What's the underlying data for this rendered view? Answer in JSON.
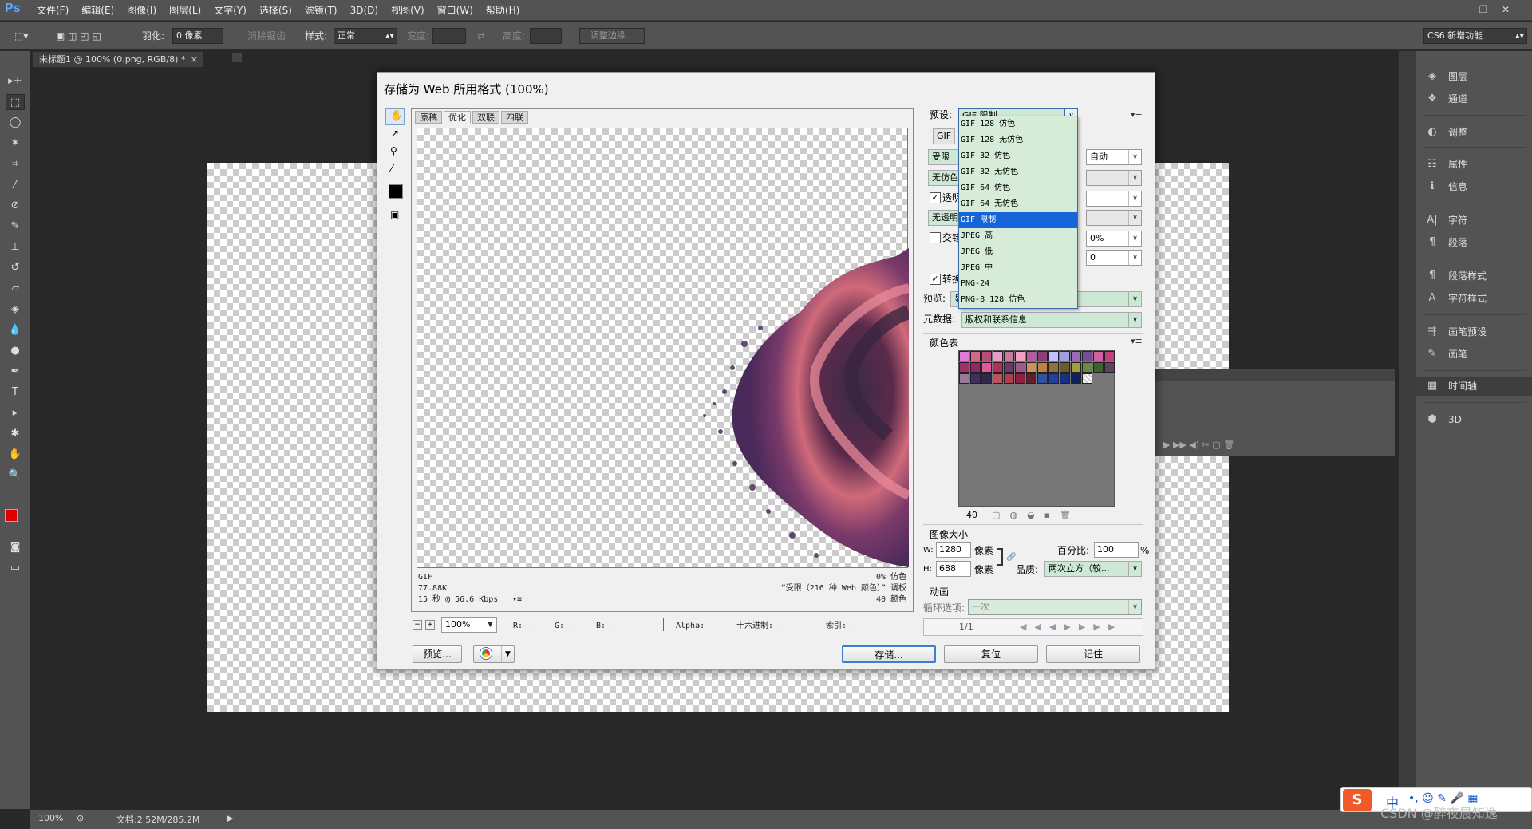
{
  "app": {
    "logo": "Ps",
    "menu": [
      "文件(F)",
      "编辑(E)",
      "图像(I)",
      "图层(L)",
      "文字(Y)",
      "选择(S)",
      "滤镜(T)",
      "3D(D)",
      "视图(V)",
      "窗口(W)",
      "帮助(H)"
    ],
    "window_buttons": [
      "—",
      "❐",
      "✕"
    ]
  },
  "options_bar": {
    "feather_label": "羽化:",
    "feather_value": "0 像素",
    "antialias_label": "消除锯齿",
    "style_label": "样式:",
    "style_value": "正常",
    "width_label": "宽度:",
    "height_label": "高度:",
    "refine_edge_button": "调整边缘...",
    "workspace": "CS6 新增功能"
  },
  "document_tab": "未标题1 @ 100% (0.png, RGB/8) *",
  "panels": {
    "items": [
      "图层",
      "通道",
      "调整",
      "属性",
      "信息",
      "字符",
      "段落",
      "段落样式",
      "字符样式",
      "画笔预设",
      "画笔",
      "时间轴",
      "3D"
    ]
  },
  "status": {
    "zoom": "100%",
    "doc_info": "文档:2.52M/285.2M"
  },
  "dialog": {
    "title": "存储为 Web 所用格式 (100%)",
    "tabs": [
      "原稿",
      "优化",
      "双联",
      "四联"
    ],
    "preview_info": {
      "format": "GIF",
      "size": "77.88K",
      "time": "15 秒 @ 56.6 Kbps",
      "dither": "0% 仿色",
      "palette": "“受限（216 种 Web 颜色）” 调板",
      "colors": "40 颜色"
    },
    "zoom_value": "100%",
    "readout": {
      "r": "R: —",
      "g": "G: —",
      "b": "B: —",
      "alpha": "Alpha: —",
      "hex": "十六进制: —",
      "index": "索引: —"
    },
    "preset_label": "预设:",
    "preset_value": "GIF 限制",
    "format_value": "GIF",
    "reduction_value": "受限",
    "dither_value": "无仿色",
    "transparency_label": "透明",
    "matte_value": "无透明",
    "interlace_label": "交错",
    "convert_label": "转换",
    "preview_label": "预览:",
    "preview_value": "显",
    "metadata_label": "元数据:",
    "metadata_value": "版权和联系信息",
    "colors_value": "自动",
    "dither_pct": "0%",
    "websnap": "0",
    "color_table_label": "颜色表",
    "color_count": "40",
    "image_size_label": "图像大小",
    "w_label": "W:",
    "w_value": "1280",
    "h_label": "H:",
    "h_value": "688",
    "px_unit": "像素",
    "percent_label": "百分比:",
    "percent_value": "100",
    "percent_unit": "%",
    "quality_label": "品质:",
    "quality_value": "两次立方（较...",
    "animation_label": "动画",
    "loop_label": "循环选项:",
    "loop_value": "一次",
    "frame_counter": "1/1",
    "buttons": {
      "preview": "预览...",
      "save": "存储...",
      "reset": "复位",
      "remember": "记住"
    },
    "dropdown_items": [
      "GIF 128 仿色",
      "GIF 128 无仿色",
      "GIF 32 仿色",
      "GIF 32 无仿色",
      "GIF 64 仿色",
      "GIF 64 无仿色",
      "GIF 限制",
      "JPEG 高",
      "JPEG 低",
      "JPEG 中",
      "PNG-24",
      "PNG-8 128 仿色"
    ],
    "dropdown_selected_index": 6,
    "swatch_colors": [
      "#e07ad8",
      "#d16a8a",
      "#b84c7a",
      "#e59ccb",
      "#c87aa0",
      "#f0a0c0",
      "#b85aa0",
      "#8a3f78",
      "#c0c0ff",
      "#a0a0e0",
      "#9a6ab8",
      "#7a4a9a",
      "#d060a0",
      "#c04080",
      "#a03070",
      "#902868",
      "#e05a9a",
      "#b0305a",
      "#6a3a6a",
      "#a05a8a",
      "#d09060",
      "#c08040",
      "#907040",
      "#6a5a30",
      "#a0a040",
      "#6a8a40",
      "#406030",
      "#604060",
      "#9a7a9a",
      "#403060",
      "#302850",
      "#c05060",
      "#b04050",
      "#902040",
      "#602030",
      "#3050a0",
      "#2040a0",
      "#1a3080",
      "#102060",
      "#000000"
    ],
    "transparent_swatch_index": 39
  },
  "watermark": "CSDN @醉夜晨知逸",
  "ime": {
    "label": "中"
  }
}
